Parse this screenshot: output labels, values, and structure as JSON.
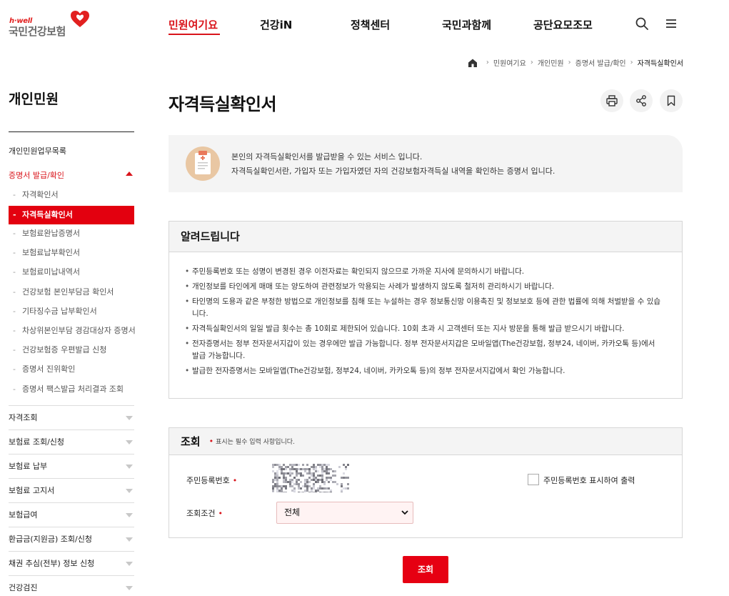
{
  "brand": {
    "logo_small": "h·well",
    "logo_main": "국민건강보험",
    "accent": "#d9141b"
  },
  "gnb": {
    "items": [
      "민원여기요",
      "건강iN",
      "정책센터",
      "국민과함께",
      "공단요모조모"
    ],
    "active_index": 0,
    "search_icon": "search-icon",
    "menu_icon": "hamburger-menu-icon"
  },
  "breadcrumb": {
    "home_icon": "home-icon",
    "items": [
      "민원여기요",
      "개인민원",
      "증명서 발급/확인",
      "자격득실확인서"
    ]
  },
  "sidebar": {
    "title": "개인민원",
    "top_link": "개인민원업무목록",
    "open_category": "증명서 발급/확인",
    "sub_items": [
      "자격확인서",
      "자격득실확인서",
      "보험료완납증명서",
      "보험료납부확인서",
      "보험료미납내역서",
      "건강보험 본인부담금 확인서",
      "기타징수금 납부확인서",
      "차상위본인부담 경감대상자 증명서",
      "건강보험증 우편발급 신청",
      "증명서 진위확인",
      "증명서 팩스발급 처리결과 조회"
    ],
    "active_sub_index": 1,
    "categories": [
      "자격조회",
      "보험료 조회/신청",
      "보험료 납부",
      "보험료 고지서",
      "보험급여",
      "환급금(지원금) 조회/신청",
      "채권 추심(전부) 정보 신청",
      "건강검진"
    ]
  },
  "main": {
    "title": "자격득실확인서",
    "tools": [
      "print-icon",
      "share-icon",
      "bookmark-icon"
    ],
    "intro": {
      "line1": "본인의 자격득실확인서를 발급받을 수 있는 서비스 입니다.",
      "line2": "자격득실확인서란, 가입자 또는 가입자였던 자의 건강보험자격득실 내역을 확인하는 증명서 입니다."
    },
    "notice": {
      "title": "알려드립니다",
      "items": [
        "주민등록번호 또는 성명이 변경된 경우 이전자료는 확인되지 않으므로 가까운 지사에 문의하시기 바랍니다.",
        "개인정보를 타인에게 매매 또는 양도하여 관련정보가 악용되는 사례가 발생하지 않도록 철저히 관리하시기 바랍니다.",
        "타인명의 도용과 같은 부정한 방법으로 개인정보를 침해 또는 누설하는 경우 정보통신망 이용촉진 및 정보보호 등에 관한 법률에 의해 처벌받을 수 있습니다.",
        "자격득실확인서의 일일 발급 횟수는 총 10회로 제한되어 있습니다. 10회 초과 시 고객센터 또는 지사 방문을 통해 발급 받으시기 바랍니다.",
        "전자증명서는 정부 전자문서지갑이 있는 경우에만 발급 가능합니다. 정부 전자문서지갑은 모바일앱(The건강보험, 정부24, 네이버, 카카오톡 등)에서 발급 가능합니다.",
        "발급한 전자증명서는 모바일앱(The건강보험, 정부24, 네이버, 카카오톡 등)의 정부 전자문서지갑에서 확인 가능합니다."
      ]
    },
    "search": {
      "title": "조회",
      "required_note": "표시는 필수 입력 사항입니다.",
      "required_mark": "•",
      "rrn_label": "주민등록번호",
      "rrn_checkbox_label": "주민등록번호 표시하여 출력",
      "condition_label": "조회조건",
      "condition_value": "전체",
      "submit_label": "조회"
    }
  }
}
